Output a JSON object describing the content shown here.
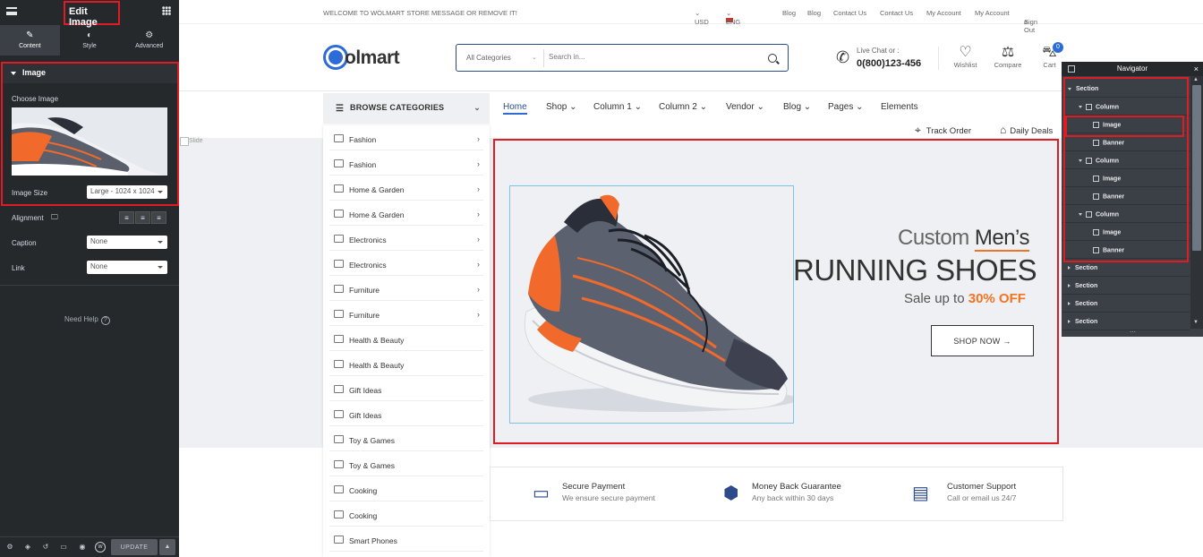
{
  "panel": {
    "title": "Edit Image",
    "tabs": [
      {
        "label": "Content",
        "icon": "pencil-icon"
      },
      {
        "label": "Style",
        "icon": "half-circle-icon"
      },
      {
        "label": "Advanced",
        "icon": "gear-icon"
      }
    ],
    "section_title": "Image",
    "choose_image_label": "Choose Image",
    "image_size_label": "Image Size",
    "image_size_value": "Large - 1024 x 1024",
    "alignment_label": "Alignment",
    "caption_label": "Caption",
    "caption_value": "None",
    "link_label": "Link",
    "link_value": "None",
    "need_help": "Need Help",
    "update_label": "UPDATE"
  },
  "topbar": {
    "welcome": "WELCOME TO WOLMART STORE MESSAGE OR REMOVE IT!",
    "currency": "USD",
    "language": "ENG",
    "links": [
      "Blog",
      "Blog",
      "Contact Us",
      "Contact Us",
      "My Account",
      "My Account"
    ],
    "sign_out": "Sign Out"
  },
  "header": {
    "logo": "olmart",
    "search_category": "All Categories",
    "search_placeholder": "Search in...",
    "live_chat": "Live Chat or :",
    "phone": "0(800)123-456",
    "wishlist": "Wishlist",
    "compare": "Compare",
    "cart": "Cart",
    "cart_count": "0"
  },
  "categories": {
    "heading": "BROWSE CATEGORIES",
    "items": [
      {
        "label": "Fashion",
        "arrow": true
      },
      {
        "label": "Fashion",
        "arrow": true
      },
      {
        "label": "Home & Garden",
        "arrow": true
      },
      {
        "label": "Home & Garden",
        "arrow": true
      },
      {
        "label": "Electronics",
        "arrow": true
      },
      {
        "label": "Electronics",
        "arrow": true
      },
      {
        "label": "Furniture",
        "arrow": true
      },
      {
        "label": "Furniture",
        "arrow": true
      },
      {
        "label": "Health & Beauty",
        "arrow": false
      },
      {
        "label": "Health & Beauty",
        "arrow": false
      },
      {
        "label": "Gift Ideas",
        "arrow": false
      },
      {
        "label": "Gift Ideas",
        "arrow": false
      },
      {
        "label": "Toy & Games",
        "arrow": false
      },
      {
        "label": "Toy & Games",
        "arrow": false
      },
      {
        "label": "Cooking",
        "arrow": false
      },
      {
        "label": "Cooking",
        "arrow": false
      },
      {
        "label": "Smart Phones",
        "arrow": false
      }
    ]
  },
  "mainnav": {
    "items": [
      "Home",
      "Shop",
      "Column 1",
      "Column 2",
      "Vendor",
      "Blog",
      "Pages",
      "Elements"
    ],
    "track_order": "Track Order",
    "daily_deals": "Daily Deals"
  },
  "slide_label": "Slide",
  "banner": {
    "custom": "Custom",
    "mens": "Men’s",
    "title": "RUNNING SHOES",
    "sale_prefix": "Sale up to",
    "sale_value": "30% OFF",
    "button": "SHOP NOW →"
  },
  "features": [
    {
      "title": "Secure Payment",
      "subtitle": "We ensure secure payment",
      "icon": "credit-card-icon"
    },
    {
      "title": "Money Back Guarantee",
      "subtitle": "Any back within 30 days",
      "icon": "money-back-icon"
    },
    {
      "title": "Customer Support",
      "subtitle": "Call or email us 24/7",
      "icon": "chat-icon"
    }
  ],
  "navigator": {
    "title": "Navigator",
    "rows": [
      {
        "label": "Section",
        "level": 0,
        "open": true
      },
      {
        "label": "Column",
        "level": 1,
        "open": true
      },
      {
        "label": "Image",
        "level": 2,
        "selected": true
      },
      {
        "label": "Banner",
        "level": 2
      },
      {
        "label": "Column",
        "level": 1,
        "open": true
      },
      {
        "label": "Image",
        "level": 2
      },
      {
        "label": "Banner",
        "level": 2
      },
      {
        "label": "Column",
        "level": 1,
        "open": true
      },
      {
        "label": "Image",
        "level": 2
      },
      {
        "label": "Banner",
        "level": 2
      },
      {
        "label": "Section",
        "level": 0,
        "open": false
      },
      {
        "label": "Section",
        "level": 0,
        "open": false
      },
      {
        "label": "Section",
        "level": 0,
        "open": false
      },
      {
        "label": "Section",
        "level": 0,
        "open": false
      }
    ]
  },
  "colors": {
    "panel_bg": "#26292c",
    "accent_blue": "#2d6bd6",
    "accent_orange": "#f47321",
    "highlight_red": "#e01b24"
  }
}
